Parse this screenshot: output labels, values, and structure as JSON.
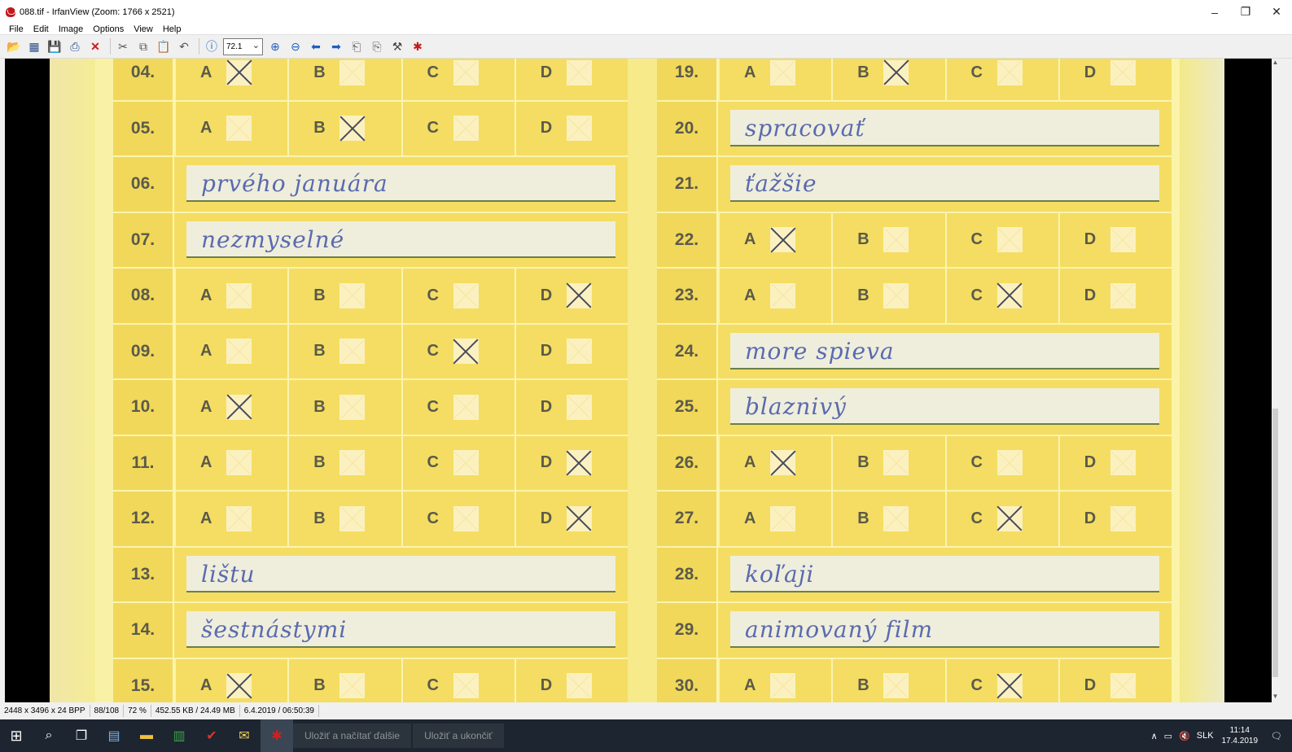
{
  "window": {
    "title": "088.tif - IrfanView (Zoom: 1766 x 2521)",
    "controls": {
      "minimize": "–",
      "restore": "❐",
      "close": "✕"
    }
  },
  "menu": [
    "File",
    "Edit",
    "Image",
    "Options",
    "View",
    "Help"
  ],
  "toolbar": {
    "zoom_value": "72.1",
    "icons": [
      "open-folder-icon",
      "thumbnails-icon",
      "save-icon",
      "print-icon",
      "delete-icon",
      "cut-icon",
      "copy-icon",
      "paste-icon",
      "undo-icon",
      "info-icon",
      "zoom-in-icon",
      "zoom-out-icon",
      "previous-icon",
      "next-icon",
      "page-first-icon",
      "page-last-icon",
      "properties-icon",
      "exit-icon"
    ]
  },
  "form": {
    "left_column": [
      {
        "num": "04.",
        "type": "mc",
        "checked": "A"
      },
      {
        "num": "05.",
        "type": "mc",
        "checked": "B"
      },
      {
        "num": "06.",
        "type": "text",
        "answer": "prvého januára"
      },
      {
        "num": "07.",
        "type": "text",
        "answer": "nezmyselné"
      },
      {
        "num": "08.",
        "type": "mc",
        "checked": "D"
      },
      {
        "num": "09.",
        "type": "mc",
        "checked": "C"
      },
      {
        "num": "10.",
        "type": "mc",
        "checked": "A"
      },
      {
        "num": "11.",
        "type": "mc",
        "checked": "D"
      },
      {
        "num": "12.",
        "type": "mc",
        "checked": "D"
      },
      {
        "num": "13.",
        "type": "text",
        "answer": "lištu"
      },
      {
        "num": "14.",
        "type": "text",
        "answer": "šestnástymi"
      },
      {
        "num": "15.",
        "type": "mc",
        "checked": "A"
      }
    ],
    "right_column": [
      {
        "num": "19.",
        "type": "mc",
        "checked": "B"
      },
      {
        "num": "20.",
        "type": "text",
        "answer": "spracovať"
      },
      {
        "num": "21.",
        "type": "text",
        "answer": "ťažšie"
      },
      {
        "num": "22.",
        "type": "mc",
        "checked": "A"
      },
      {
        "num": "23.",
        "type": "mc",
        "checked": "C"
      },
      {
        "num": "24.",
        "type": "text",
        "answer": "more spieva"
      },
      {
        "num": "25.",
        "type": "text",
        "answer": "blaznivý"
      },
      {
        "num": "26.",
        "type": "mc",
        "checked": "A"
      },
      {
        "num": "27.",
        "type": "mc",
        "checked": "C"
      },
      {
        "num": "28.",
        "type": "text",
        "answer": "koľaji"
      },
      {
        "num": "29.",
        "type": "text",
        "answer": "animovaný film"
      },
      {
        "num": "30.",
        "type": "mc",
        "checked": "C"
      }
    ],
    "options": [
      "A",
      "B",
      "C",
      "D"
    ]
  },
  "status": {
    "image_info": "2448 x 3496 x 24 BPP",
    "index": "88/108",
    "zoom": "72 %",
    "size": "452.55 KB / 24.49 MB",
    "datetime": "6.4.2019 / 06:50:39"
  },
  "taskbar": {
    "tasks": [
      "Uložiť a načítať ďalšie",
      "Uložiť a ukončiť"
    ],
    "language": "SLK",
    "time": "11:14",
    "date": "17.4.2019"
  }
}
